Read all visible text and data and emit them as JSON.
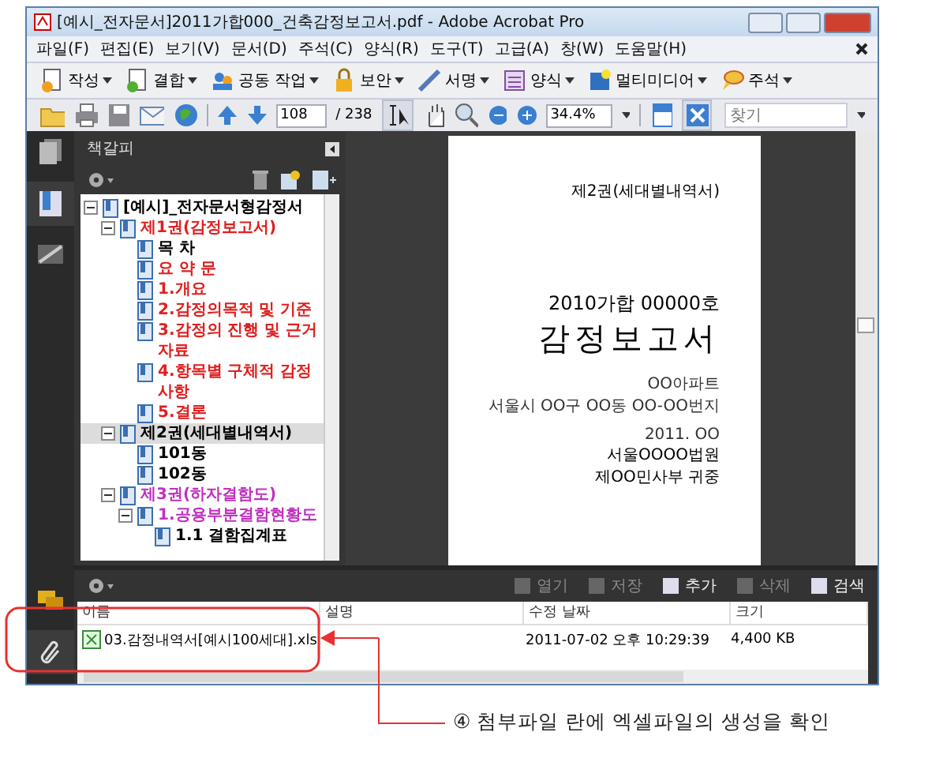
{
  "window": {
    "title": "[예시_전자문서]2011가합000_건축감정보고서.pdf - Adobe Acrobat Pro"
  },
  "menu": [
    "파일(F)",
    "편집(E)",
    "보기(V)",
    "문서(D)",
    "주석(C)",
    "양식(R)",
    "도구(T)",
    "고급(A)",
    "창(W)",
    "도움말(H)"
  ],
  "task_toolbar": [
    {
      "label": "작성",
      "kind": "create"
    },
    {
      "label": "결합",
      "kind": "combine"
    },
    {
      "label": "공동 작업",
      "kind": "collaborate"
    },
    {
      "label": "보안",
      "kind": "secure"
    },
    {
      "label": "서명",
      "kind": "sign"
    },
    {
      "label": "양식",
      "kind": "forms"
    },
    {
      "label": "멀티미디어",
      "kind": "multimedia"
    },
    {
      "label": "주석",
      "kind": "comment"
    }
  ],
  "nav_toolbar": {
    "page": "108",
    "page_total": "/ 238",
    "zoom": "34.4%",
    "find_placeholder": "찾기"
  },
  "bookmarks": {
    "title": "책갈피",
    "tree": [
      {
        "label": "[예시]_전자문서형감정서",
        "color": "#000000",
        "selected": false,
        "expanded": true,
        "children": [
          {
            "label": "제1권(감정보고서)",
            "color": "#e02020",
            "selected": false,
            "expanded": true,
            "children": [
              {
                "label": "목 차",
                "color": "#000000",
                "selected": false
              },
              {
                "label": "요 약 문",
                "color": "#e02020",
                "selected": false
              },
              {
                "label": "1.개요",
                "color": "#e02020",
                "selected": false
              },
              {
                "label": "2.감정의목적 및 기준",
                "color": "#e02020",
                "selected": false
              },
              {
                "label": "3.감정의 진행 및 근거자료",
                "color": "#e02020",
                "selected": false
              },
              {
                "label": "4.항목별 구체적 감정사항",
                "color": "#e02020",
                "selected": false
              },
              {
                "label": "5.결론",
                "color": "#e02020",
                "selected": false
              }
            ]
          },
          {
            "label": "제2권(세대별내역서)",
            "color": "#000000",
            "selected": true,
            "expanded": true,
            "children": [
              {
                "label": "101동",
                "color": "#000000",
                "selected": false
              },
              {
                "label": "102동",
                "color": "#000000",
                "selected": false
              }
            ]
          },
          {
            "label": "제3권(하자결함도)",
            "color": "#c030c0",
            "selected": false,
            "expanded": true,
            "children": [
              {
                "label": "1.공용부분결함현황도",
                "color": "#c030c0",
                "selected": false,
                "expanded": true,
                "children": [
                  {
                    "label": "1.1 결함집계표",
                    "color": "#000000",
                    "selected": false
                  }
                ]
              }
            ]
          }
        ]
      }
    ]
  },
  "document_page": {
    "volume": "제2권(세대별내역서)",
    "case_no": "2010가합  00000호",
    "title": "감정보고서",
    "lines": [
      "OO아파트",
      "서울시 OO구 OO동 OO-OO번지"
    ],
    "date": "2011. OO",
    "court": "서울OOOO법원",
    "department": "제OO민사부  귀중"
  },
  "attachments": {
    "toolbar": [
      {
        "label": "열기",
        "disabled": true
      },
      {
        "label": "저장",
        "disabled": true
      },
      {
        "label": "추가",
        "disabled": false
      },
      {
        "label": "삭제",
        "disabled": true
      },
      {
        "label": "검색",
        "disabled": false
      }
    ],
    "columns": [
      "이름",
      "설명",
      "수정 날짜",
      "크기"
    ],
    "rows": [
      {
        "name": "03.감정내역서[예시100세대].xls",
        "modified": "2011-07-02 오후 10:29:39",
        "size": "4,400 KB"
      }
    ]
  },
  "callout": {
    "text": "④ 첨부파일 란에 엑셀파일의 생성을 확인"
  }
}
